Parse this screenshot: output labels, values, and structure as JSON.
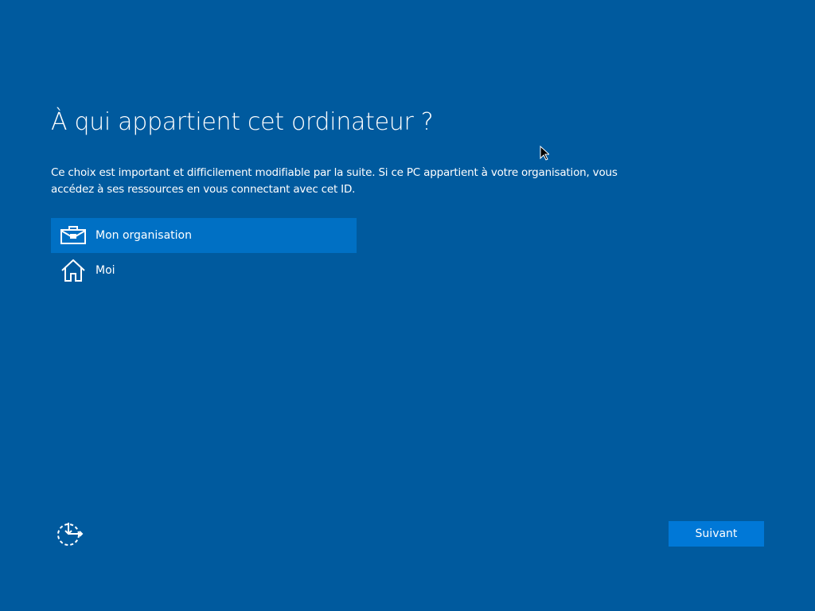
{
  "title": "À qui appartient cet ordinateur ?",
  "description": "Ce choix est important et difficilement modifiable par la suite. Si ce PC appartient à votre organisation, vous accédez à ses ressources en vous connectant avec cet ID.",
  "options": [
    {
      "label": "Mon organisation",
      "icon": "briefcase-icon",
      "selected": true
    },
    {
      "label": "Moi",
      "icon": "home-icon",
      "selected": false
    }
  ],
  "next_label": "Suivant",
  "colors": {
    "background": "#005a9e",
    "selected": "#0070c4",
    "button": "#0078d7"
  }
}
